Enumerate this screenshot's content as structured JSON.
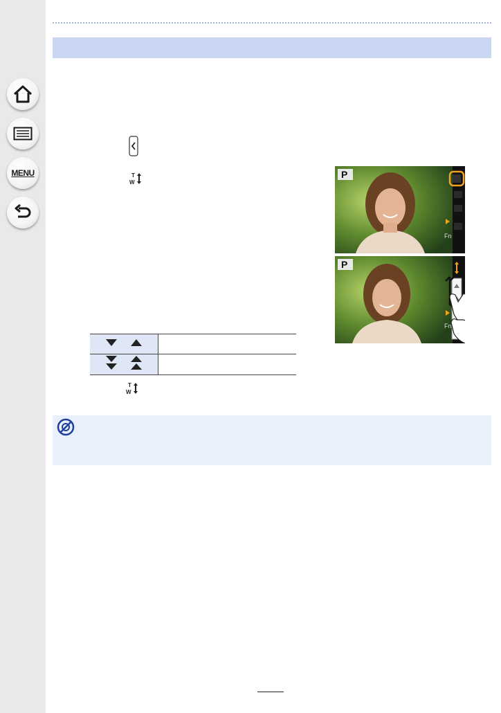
{
  "sidebar": {
    "items": [
      {
        "name": "home",
        "icon": "home-icon"
      },
      {
        "name": "contents",
        "icon": "list-icon"
      },
      {
        "name": "menu",
        "icon": "menu-icon",
        "label": "MENU"
      },
      {
        "name": "back",
        "icon": "back-arrow-icon"
      }
    ]
  },
  "colors": {
    "sidebar": "#e9e9e9",
    "header_band": "#c9d7f2",
    "note_box": "#eaf0fb",
    "table_head_cell": "#dfe6f5",
    "highlight": "#f2a21b"
  },
  "icons": {
    "tab": "left-tab-chevron-icon",
    "zoom": "zoom-tw-icon",
    "note": "not-available-icon",
    "slow": "single-arrows-icon",
    "fast": "double-arrows-icon"
  },
  "zoom_icon": {
    "t": "T",
    "w": "W"
  },
  "screens": {
    "mode_label": "P",
    "fn_label": "Fn"
  }
}
